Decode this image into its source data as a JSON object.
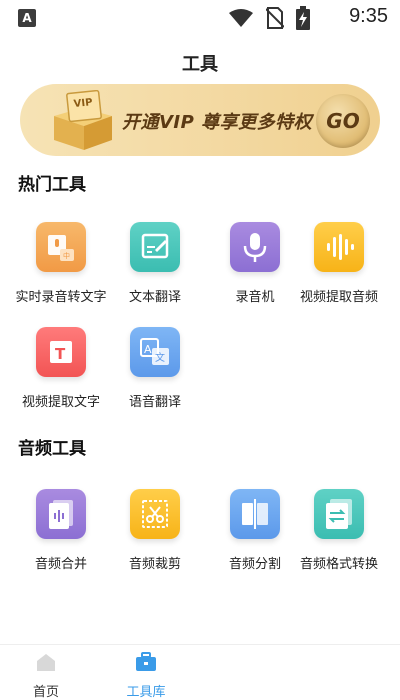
{
  "status_bar": {
    "left_icon_letter": "A",
    "time": "9:35"
  },
  "page": {
    "title": "工具"
  },
  "vip_banner": {
    "badge": "VIP",
    "text": "开通VIP  尊享更多特权",
    "go_label": "GO",
    "colors": {
      "bg_start": "#f6e3b5",
      "bg_end": "#f0d08f",
      "text": "#5b3a14"
    }
  },
  "sections": [
    {
      "title": "热门工具",
      "tools": [
        {
          "label": "实时录音转文字",
          "icon": "speech-to-text-icon",
          "color": "orange"
        },
        {
          "label": "文本翻译",
          "icon": "text-edit-icon",
          "color": "teal"
        },
        {
          "label": "录音机",
          "icon": "microphone-icon",
          "color": "purple"
        },
        {
          "label": "视频提取音频",
          "icon": "audio-wave-icon",
          "color": "yellow"
        },
        {
          "label": "视频提取文字",
          "icon": "text-t-icon",
          "color": "red"
        },
        {
          "label": "语音翻译",
          "icon": "translate-icon",
          "color": "blue"
        }
      ]
    },
    {
      "title": "音频工具",
      "tools": [
        {
          "label": "音频合并",
          "icon": "audio-merge-icon",
          "color": "purple"
        },
        {
          "label": "音频裁剪",
          "icon": "scissors-icon",
          "color": "yellow"
        },
        {
          "label": "音频分割",
          "icon": "split-icon",
          "color": "blue"
        },
        {
          "label": "音频格式转换",
          "icon": "convert-icon",
          "color": "teal"
        }
      ]
    }
  ],
  "bottom_nav": {
    "items": [
      {
        "label": "首页",
        "icon": "home-icon",
        "active": false
      },
      {
        "label": "工具库",
        "icon": "toolbox-icon",
        "active": true
      }
    ],
    "active_color": "#3a9be8",
    "inactive_color": "#333333"
  }
}
